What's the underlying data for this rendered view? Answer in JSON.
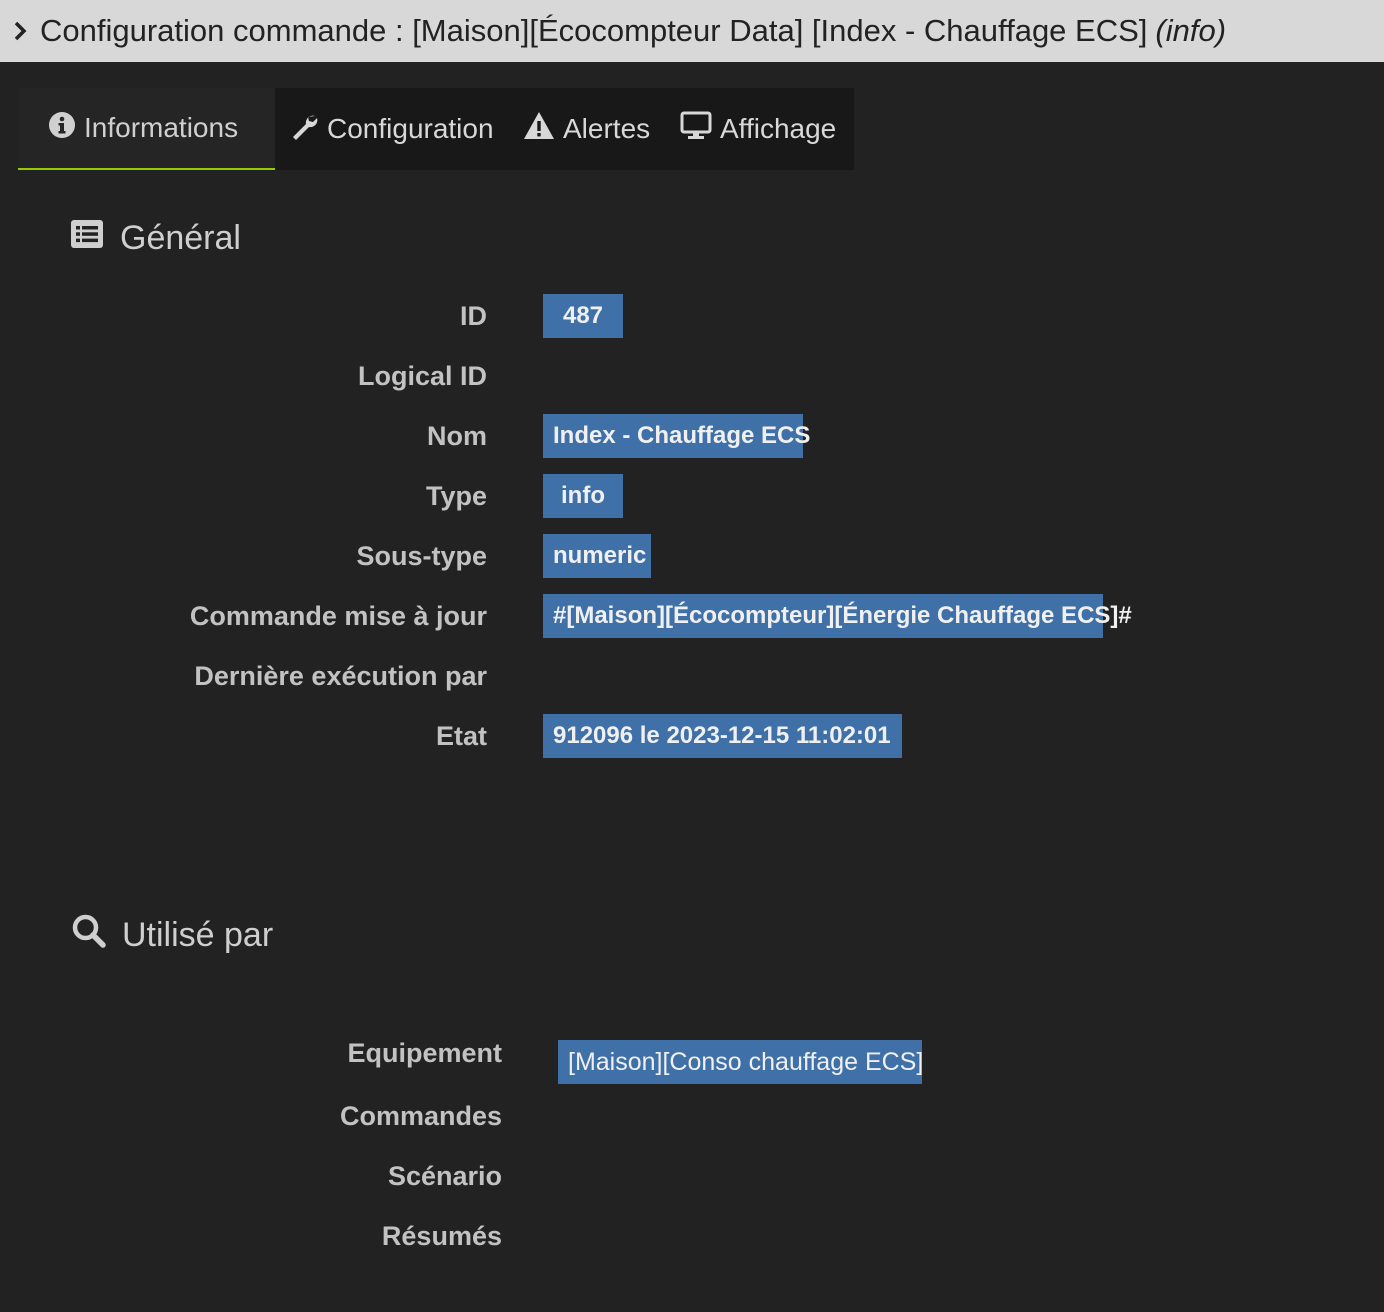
{
  "window": {
    "title": "Configuration commande : [Maison][Écocompteur Data] [Index - Chauffage ECS]",
    "title_suffix": "(info)"
  },
  "tabs": [
    {
      "label": "Informations",
      "icon": "info-circle-icon",
      "active": true
    },
    {
      "label": "Configuration",
      "icon": "wrench-icon",
      "active": false
    },
    {
      "label": "Alertes",
      "icon": "warning-icon",
      "active": false
    },
    {
      "label": "Affichage",
      "icon": "monitor-icon",
      "active": false
    }
  ],
  "general": {
    "title": "Général",
    "fields": {
      "id": {
        "label": "ID",
        "value": "487"
      },
      "logical_id": {
        "label": "Logical ID",
        "value": ""
      },
      "nom": {
        "label": "Nom",
        "value": "Index - Chauffage ECS"
      },
      "type": {
        "label": "Type",
        "value": "info"
      },
      "sous_type": {
        "label": "Sous-type",
        "value": "numeric"
      },
      "commande_maj": {
        "label": "Commande mise à jour",
        "value": "#[Maison][Écocompteur][Énergie Chauffage ECS]#"
      },
      "derniere_exec": {
        "label": "Dernière exécution par",
        "value": ""
      },
      "etat": {
        "label": "Etat",
        "value": "912096 le 2023-12-15 11:02:01"
      }
    }
  },
  "used_by": {
    "title": "Utilisé par",
    "fields": {
      "equipement": {
        "label": "Equipement",
        "value": "[Maison][Conso chauffage ECS]"
      },
      "commandes": {
        "label": "Commandes"
      },
      "scenario": {
        "label": "Scénario"
      },
      "resumes": {
        "label": "Résumés"
      }
    }
  },
  "colors": {
    "background": "#222222",
    "titlebar": "#d8d8d8",
    "badge": "#3f70a8",
    "active_tab_underline": "#94ca02"
  }
}
